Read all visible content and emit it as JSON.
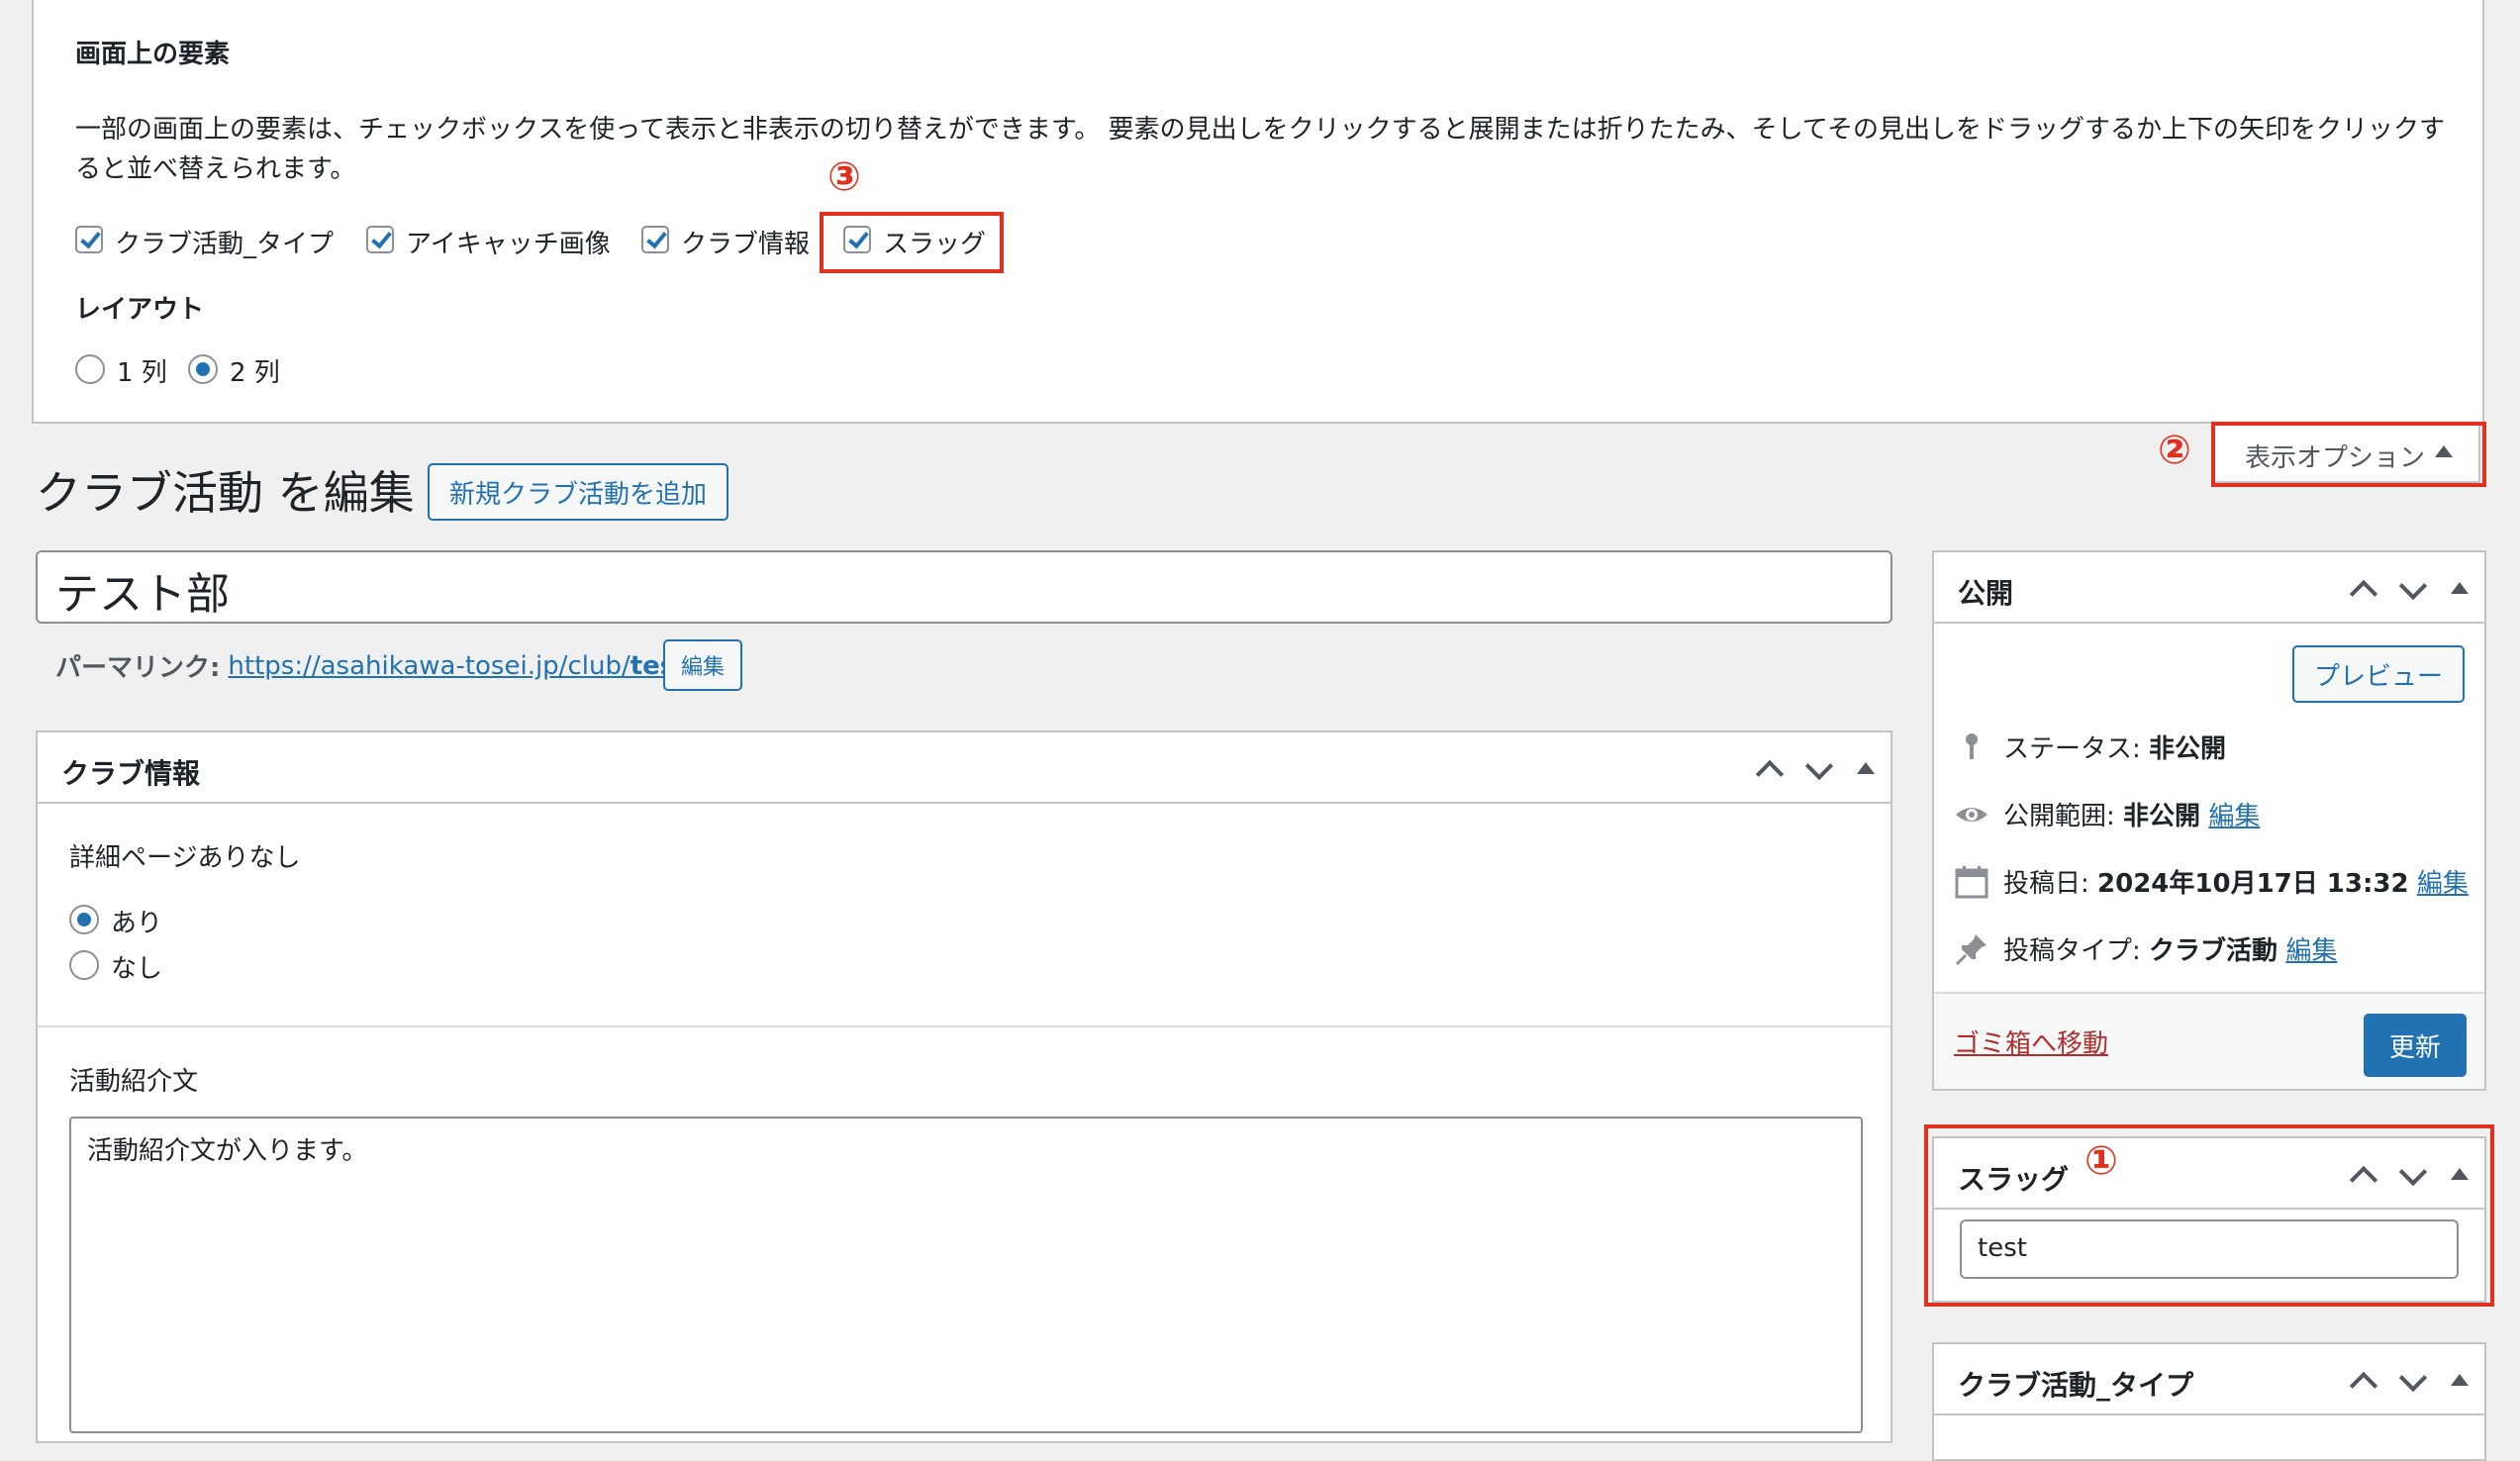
{
  "screen_options": {
    "title": "画面上の要素",
    "description_line1": "一部の画面上の要素は、チェックボックスを使って表示と非表示の切り替えができます。 要素の見出しをクリックすると展開または折りたたみ、そしてその見出しをドラッグするか上下の矢印をクリックす",
    "description_line2": "ると並べ替えられます。",
    "checkboxes": [
      {
        "label": "クラブ活動_タイプ",
        "checked": true
      },
      {
        "label": "アイキャッチ画像",
        "checked": true
      },
      {
        "label": "クラブ情報",
        "checked": true
      },
      {
        "label": "スラッグ",
        "checked": true
      }
    ],
    "layout_title": "レイアウト",
    "layout_options": [
      {
        "label": "1 列",
        "selected": false
      },
      {
        "label": "2 列",
        "selected": true
      }
    ],
    "tab_label": "表示オプション"
  },
  "annotations": {
    "n1": "①",
    "n2": "②",
    "n3": "③",
    "color": "#e0301e"
  },
  "page": {
    "heading": "クラブ活動 を編集",
    "add_new": "新規クラブ活動を追加",
    "post_title": "テスト部",
    "permalink_label": "パーマリンク:",
    "permalink_base": "https://asahikawa-tosei.jp/club/",
    "permalink_slug": "test",
    "permalink_tail": "/",
    "permalink_edit": "編集"
  },
  "club_info": {
    "title": "クラブ情報",
    "detail_label": "詳細ページありなし",
    "options": [
      {
        "label": "あり",
        "selected": true
      },
      {
        "label": "なし",
        "selected": false
      }
    ],
    "intro_label": "活動紹介文",
    "intro_value": "活動紹介文が入ります。"
  },
  "publish": {
    "title": "公開",
    "preview": "プレビュー",
    "status_label": "ステータス:",
    "status_value": "非公開",
    "visibility_label": "公開範囲:",
    "visibility_value": "非公開",
    "visibility_edit": "編集",
    "date_label": "投稿日:",
    "date_value": "2024年10月17日 13:32",
    "date_edit": "編集",
    "type_label": "投稿タイプ:",
    "type_value": "クラブ活動",
    "type_edit": "編集",
    "trash": "ゴミ箱へ移動",
    "update": "更新"
  },
  "slug_box": {
    "title": "スラッグ",
    "value": "test"
  },
  "type_box": {
    "title": "クラブ活動_タイプ"
  },
  "colors": {
    "accent": "#2271b1",
    "annotation": "#e0301e",
    "trash": "#b32d2e"
  }
}
